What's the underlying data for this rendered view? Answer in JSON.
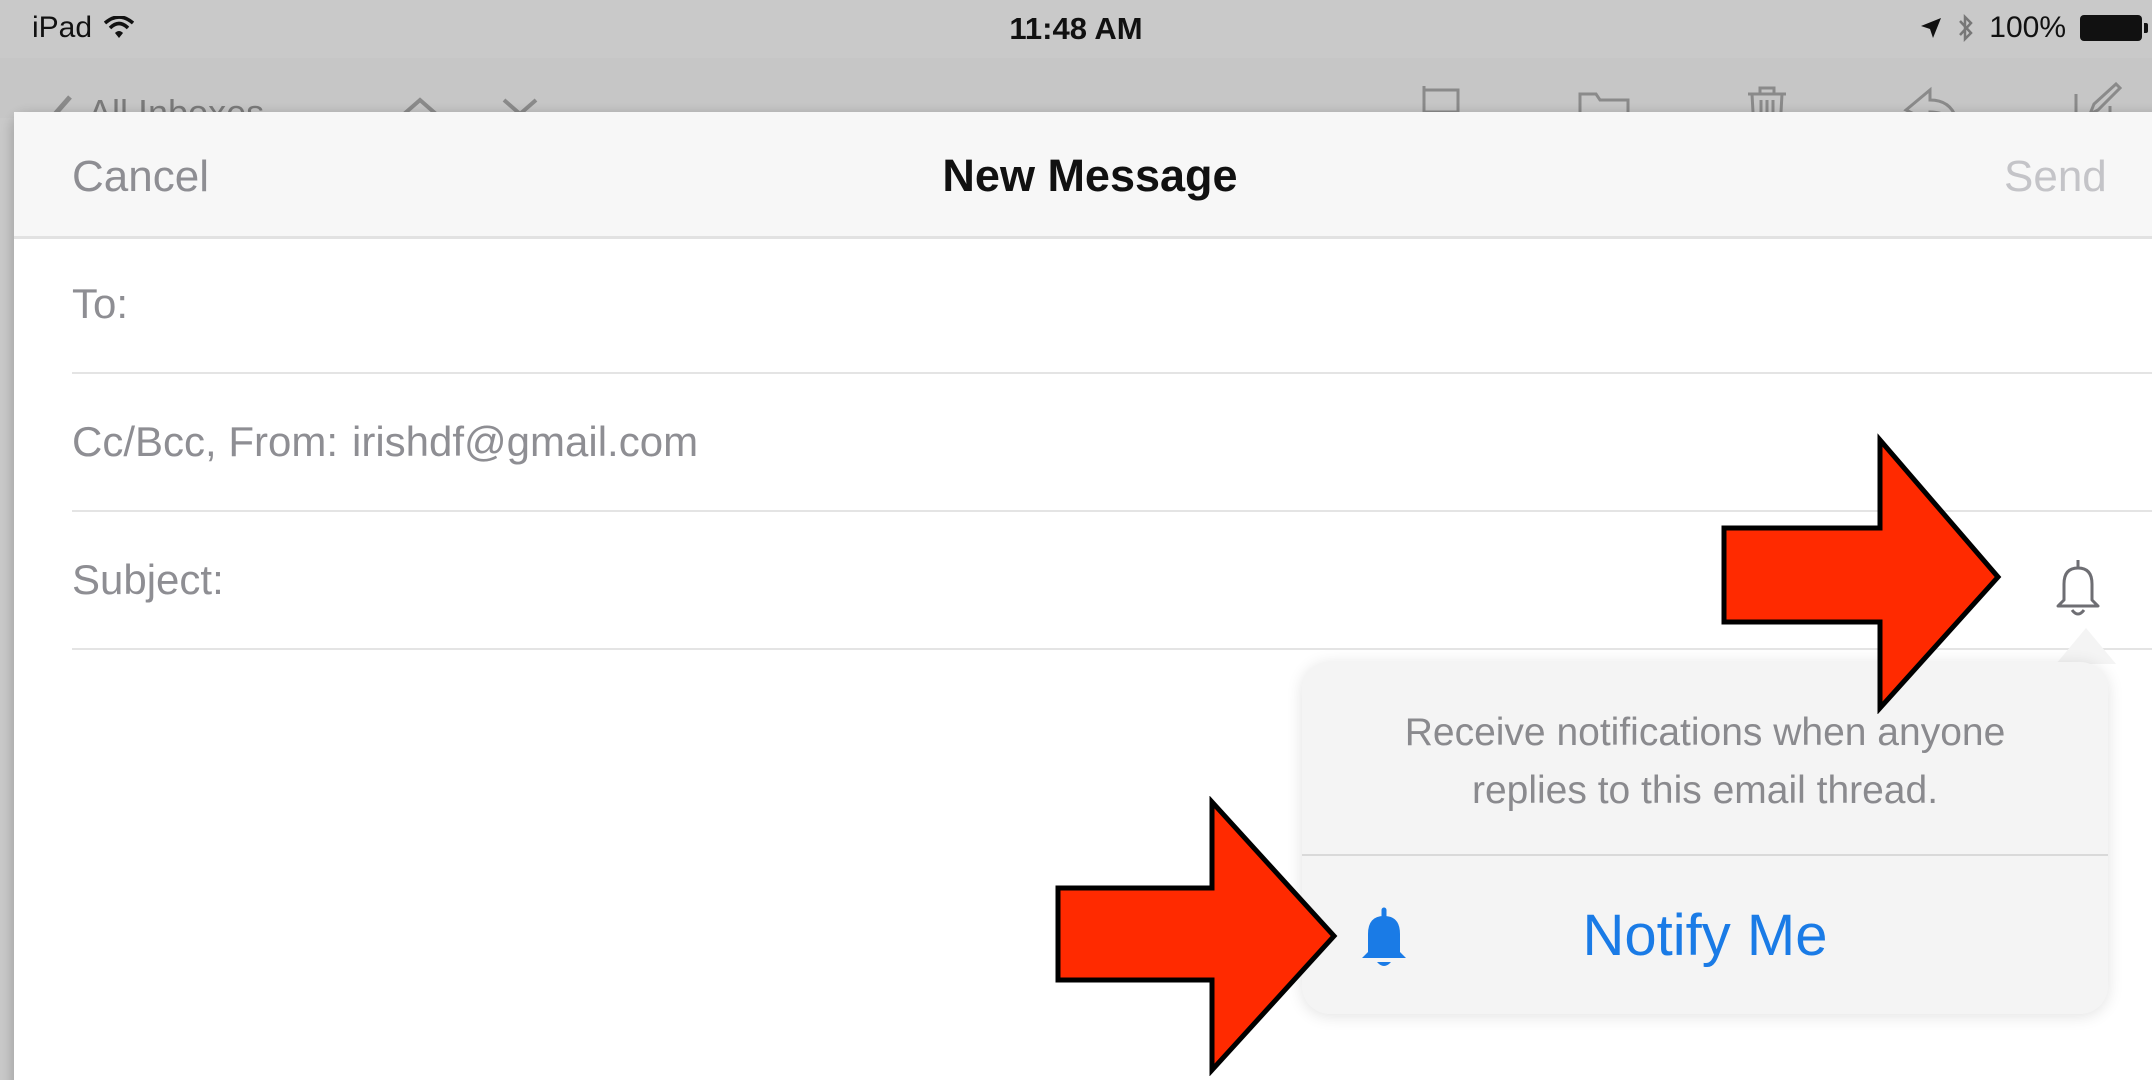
{
  "status_bar": {
    "device": "iPad",
    "time": "11:48 AM",
    "battery": "100%"
  },
  "background_toolbar": {
    "back_label": "All Inboxes"
  },
  "compose": {
    "cancel_label": "Cancel",
    "title": "New Message",
    "send_label": "Send",
    "to_label": "To:",
    "cc_label": "Cc/Bcc, From:",
    "from_value": "irishdf@gmail.com",
    "subject_label": "Subject:"
  },
  "popover": {
    "message_line1": "Receive notifications when anyone",
    "message_line2": "replies to this email thread.",
    "action_label": "Notify Me"
  },
  "colors": {
    "accent": "#1a7be6",
    "annotation_red": "#ff2a00",
    "muted_text": "#8e8e93"
  },
  "icons": {
    "wifi": "wifi-icon",
    "location": "location-arrow-icon",
    "bluetooth": "bluetooth-icon",
    "battery": "battery-icon",
    "subject_bell": "bell-outline-icon",
    "notify_bell": "bell-filled-icon"
  }
}
